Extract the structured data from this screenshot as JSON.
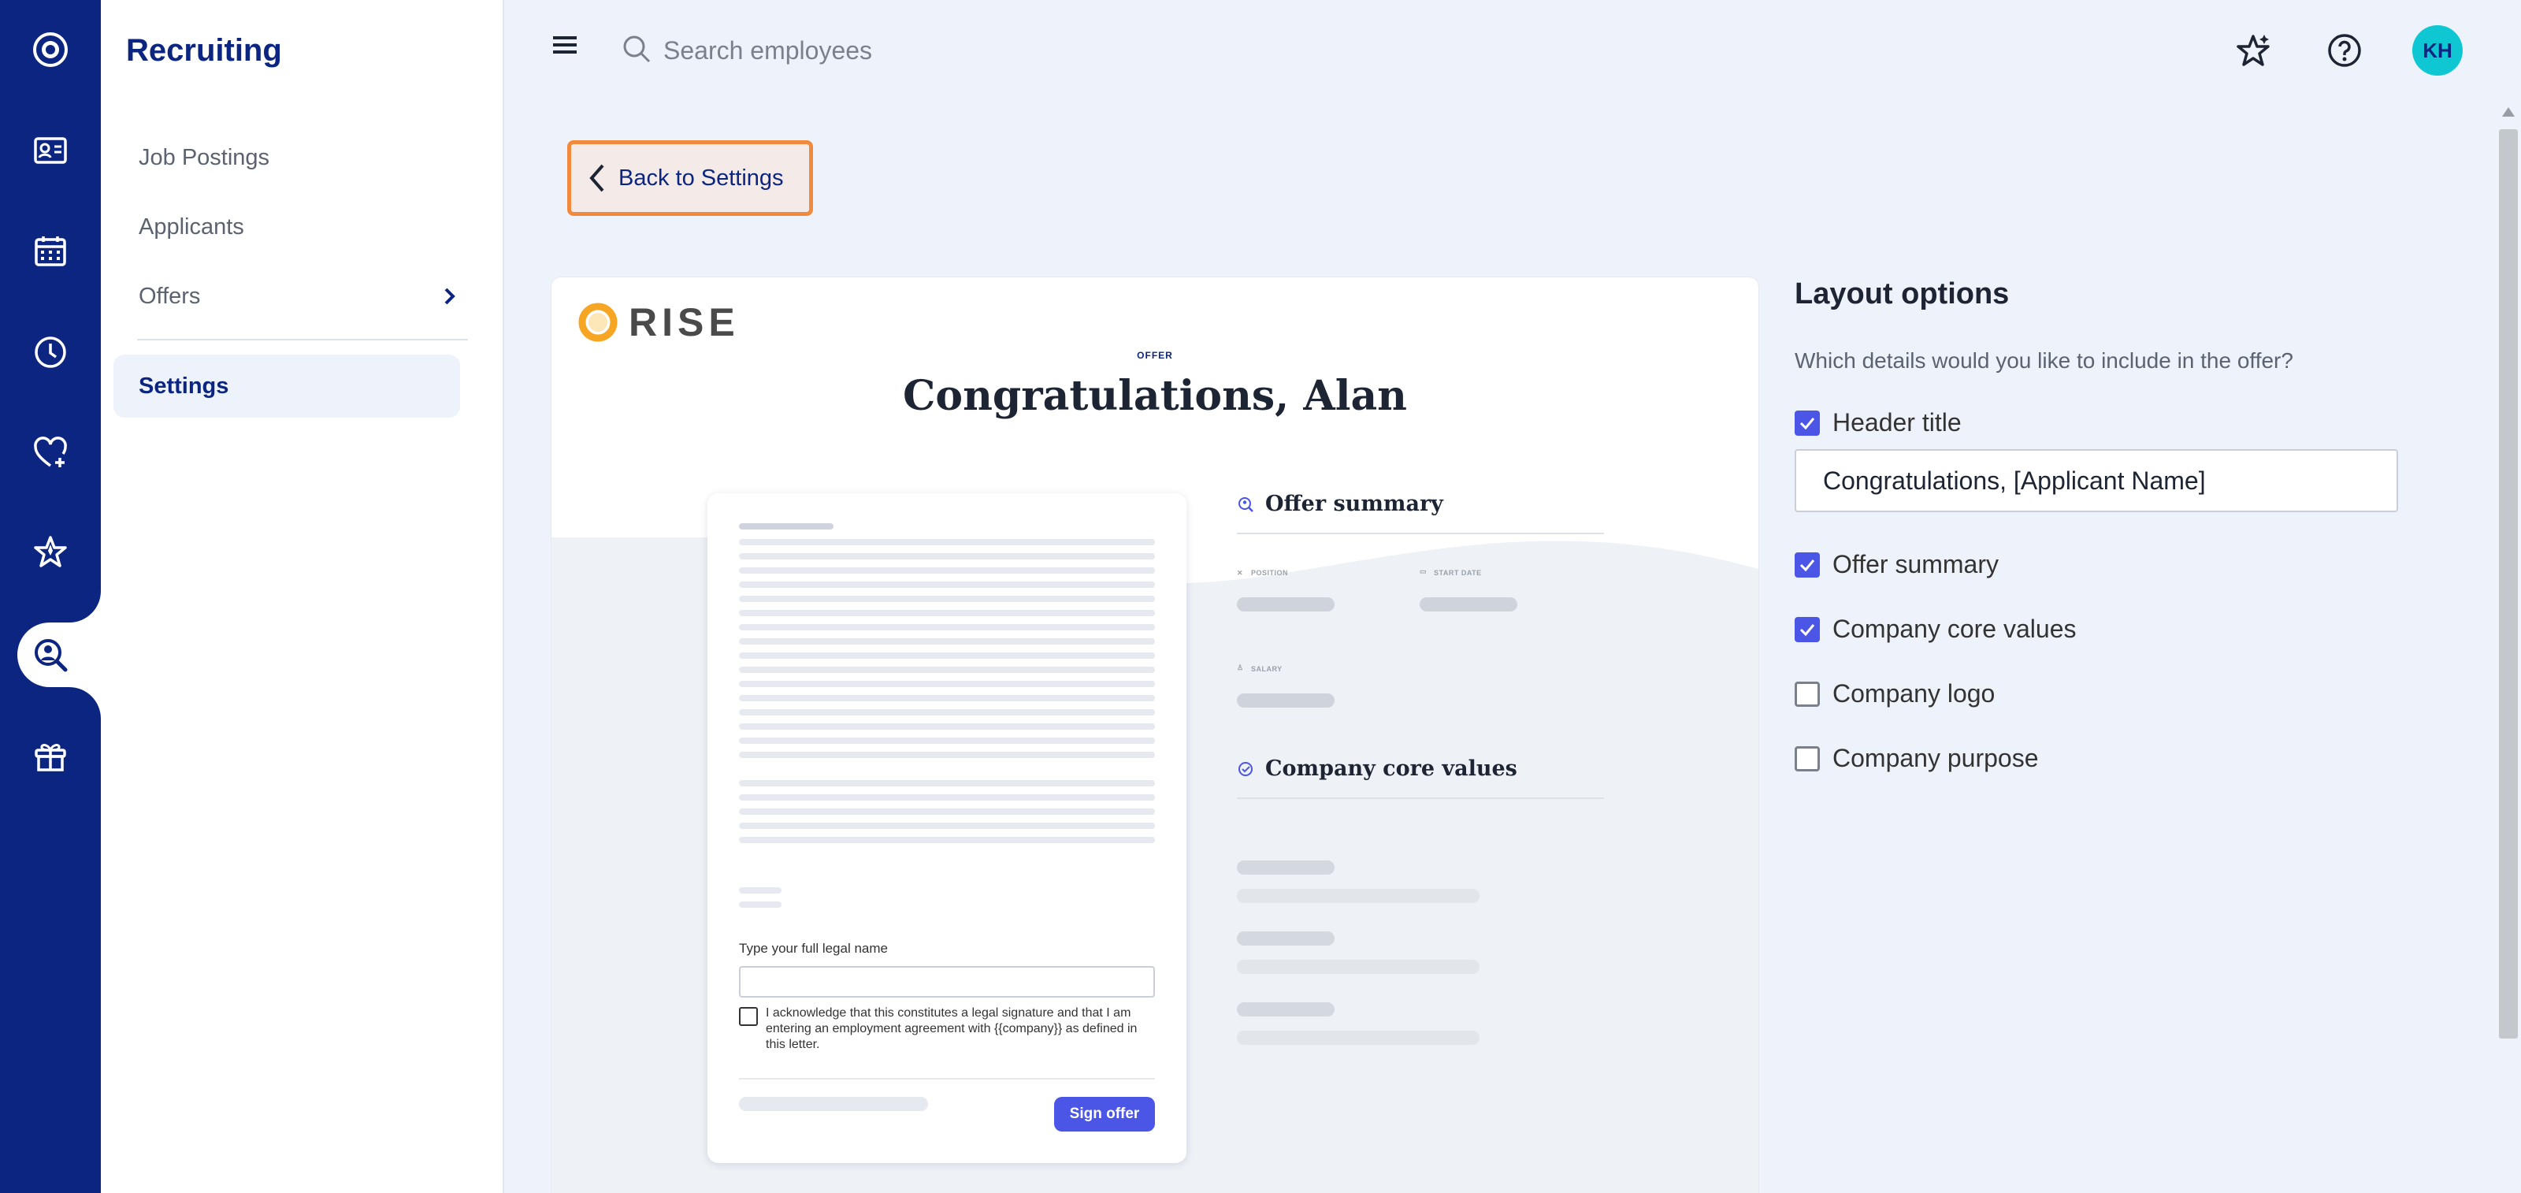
{
  "rail": {
    "items": [
      {
        "icon": "logo-ring-icon"
      },
      {
        "icon": "id-card-icon"
      },
      {
        "icon": "calendar-icon"
      },
      {
        "icon": "clock-icon"
      },
      {
        "icon": "heart-plus-icon"
      },
      {
        "icon": "star-icon"
      },
      {
        "icon": "recruiting-search-icon",
        "active": true
      },
      {
        "icon": "gift-box-icon"
      }
    ]
  },
  "subnav": {
    "title": "Recruiting",
    "items": [
      {
        "label": "Job Postings"
      },
      {
        "label": "Applicants"
      },
      {
        "label": "Offers"
      },
      {
        "label": "Settings",
        "active": true
      }
    ]
  },
  "topbar": {
    "search_placeholder": "Search employees",
    "avatar_initials": "KH"
  },
  "back_button": {
    "label": "Back to Settings"
  },
  "preview": {
    "logo_text": "RISE",
    "eyebrow": "OFFER",
    "heading": "Congratulations, Alan",
    "signature_label": "Type your full legal name",
    "acknowledgement": "I acknowledge that this constitutes a legal signature and that I am entering an employment agreement with {{company}} as defined in this letter.",
    "sign_button": "Sign offer",
    "offer_summary": {
      "title": "Offer summary",
      "fields": {
        "position": "POSITION",
        "start_date": "START DATE",
        "salary": "SALARY"
      }
    },
    "core_values": {
      "title": "Company core values"
    }
  },
  "layout_options": {
    "title": "Layout options",
    "subtitle": "Which details would you like to include in the offer?",
    "options": [
      {
        "label": "Header title",
        "checked": true
      },
      {
        "label": "Offer summary",
        "checked": true
      },
      {
        "label": "Company core values",
        "checked": true
      },
      {
        "label": "Company logo",
        "checked": false
      },
      {
        "label": "Company purpose",
        "checked": false
      }
    ],
    "header_title_value": "Congratulations, [Applicant Name]"
  },
  "colors": {
    "rail": "#0c2580",
    "accent": "#4b55e6",
    "highlight": "#f08a3c",
    "avatar": "#0fc7d2"
  }
}
